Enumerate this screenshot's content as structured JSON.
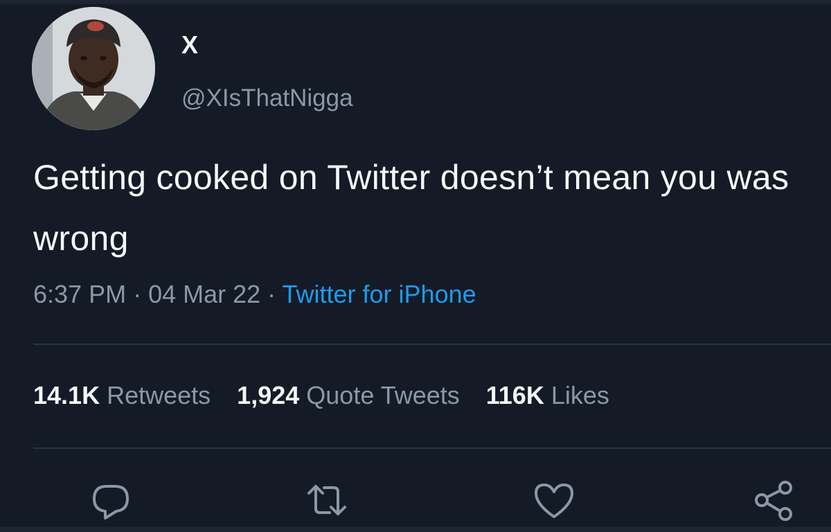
{
  "author": {
    "display_name": "X",
    "handle": "@XIsThatNigga",
    "avatar_icon": "profile-photo"
  },
  "tweet": {
    "text": "Getting cooked on Twitter doesn’t mean you was wrong"
  },
  "meta": {
    "time": "6:37 PM",
    "separator": " · ",
    "date": "04 Mar 22",
    "source": "Twitter for iPhone"
  },
  "stats": {
    "retweets_count": "14.1K",
    "retweets_label": "Retweets",
    "quotes_count": "1,924",
    "quotes_label": "Quote Tweets",
    "likes_count": "116K",
    "likes_label": "Likes"
  },
  "actions": [
    {
      "icon": "reply-icon"
    },
    {
      "icon": "retweet-icon"
    },
    {
      "icon": "like-icon"
    },
    {
      "icon": "share-icon"
    }
  ],
  "colors": {
    "background": "#141b26",
    "text_primary": "#f5f8fa",
    "text_secondary": "#8b98a5",
    "link": "#1d9bf0",
    "divider": "#2a3440"
  }
}
